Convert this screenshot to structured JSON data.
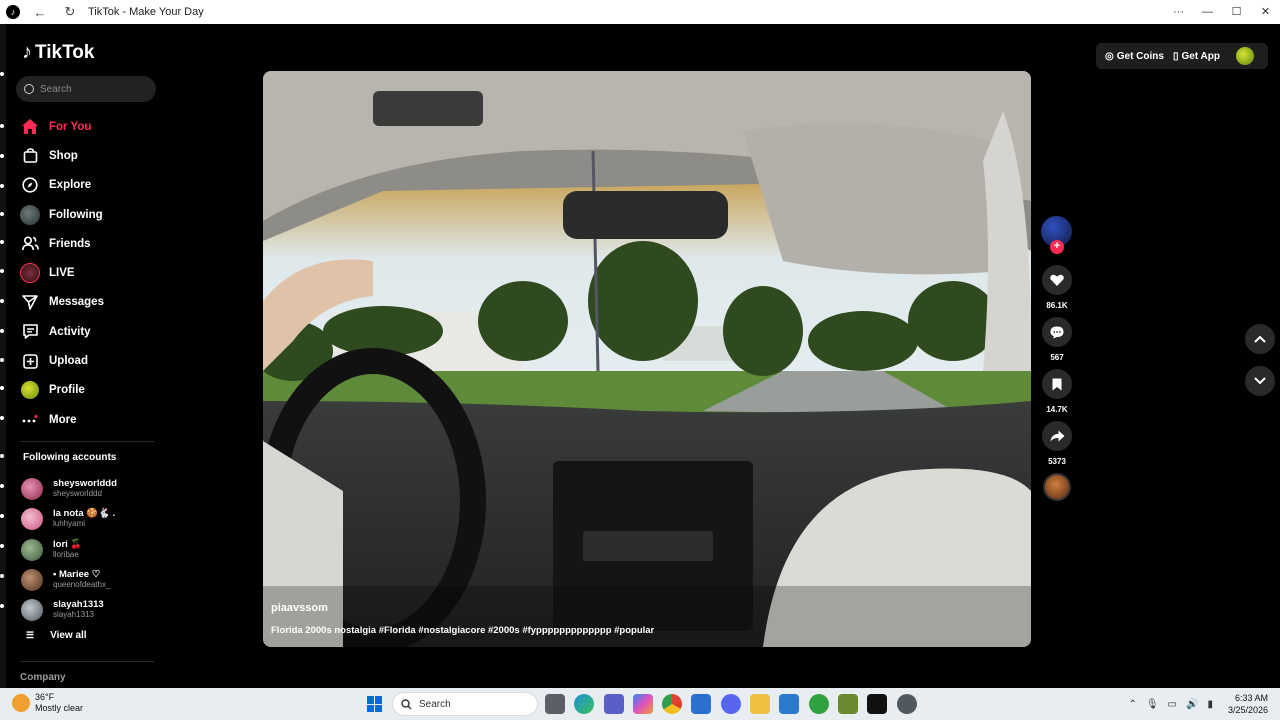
{
  "window": {
    "title": "TikTok - Make Your Day",
    "app_icon": "tiktok-icon",
    "nav": [
      "back-arrow-icon",
      "refresh-icon"
    ],
    "controls": [
      "···",
      "—",
      "☐",
      "✕"
    ]
  },
  "sidebar": {
    "logo_text": "TikTok",
    "search_placeholder": "Search",
    "nav_items": [
      {
        "label": "For You",
        "icon": "home-icon",
        "active": true
      },
      {
        "label": "Shop",
        "icon": "shop-bag-icon"
      },
      {
        "label": "Explore",
        "icon": "compass-icon"
      },
      {
        "label": "Following",
        "icon": "following-avatar-icon"
      },
      {
        "label": "Friends",
        "icon": "friends-icon"
      },
      {
        "label": "LIVE",
        "icon": "live-avatar-icon"
      },
      {
        "label": "Messages",
        "icon": "paper-plane-icon"
      },
      {
        "label": "Activity",
        "icon": "activity-icon"
      },
      {
        "label": "Upload",
        "icon": "plus-square-icon"
      },
      {
        "label": "Profile",
        "icon": "profile-avatar-icon"
      },
      {
        "label": "More",
        "icon": "more-dots-icon"
      }
    ],
    "following_heading": "Following accounts",
    "following": [
      {
        "name": "sheysworlddd",
        "handle": "sheysworlddd",
        "color": "#c04a7a"
      },
      {
        "name": "la nota 🍪🐇 .",
        "handle": "luhhyami",
        "color": "#e05a8a"
      },
      {
        "name": "lori 🍒",
        "handle": "lloribae",
        "color": "#5a7a60"
      },
      {
        "name": "• Mariee ♡",
        "handle": "queenofdeathx_",
        "color": "#7a5a40"
      },
      {
        "name": "slayah1313",
        "handle": "slayah1313",
        "color": "#808890"
      }
    ],
    "view_all": "View all",
    "company": "Company"
  },
  "video": {
    "username": "piaavssom",
    "caption": "Florida 2000s nostalgia #Florida #nostalgiacore #2000s #fyppppppppppppp #popular"
  },
  "actions": {
    "likes": "86.1K",
    "comments": "567",
    "saves": "14.7K",
    "shares": "5373"
  },
  "topbar": {
    "get_coins": "Get Coins",
    "get_app": "Get App"
  },
  "taskbar": {
    "temp": "36°F",
    "condition": "Mostly clear",
    "search": "Search",
    "time": "6:33 AM",
    "date": "3/25/2026",
    "pinned": [
      "file-explorer-icon",
      "edge-icon",
      "teams-icon",
      "copilot-icon",
      "chrome-icon",
      "store-icon",
      "discord-icon",
      "folder-icon",
      "c-app-icon",
      "xbox-icon",
      "minecraft-icon",
      "tiktok-app-icon",
      "recorder-icon"
    ]
  }
}
